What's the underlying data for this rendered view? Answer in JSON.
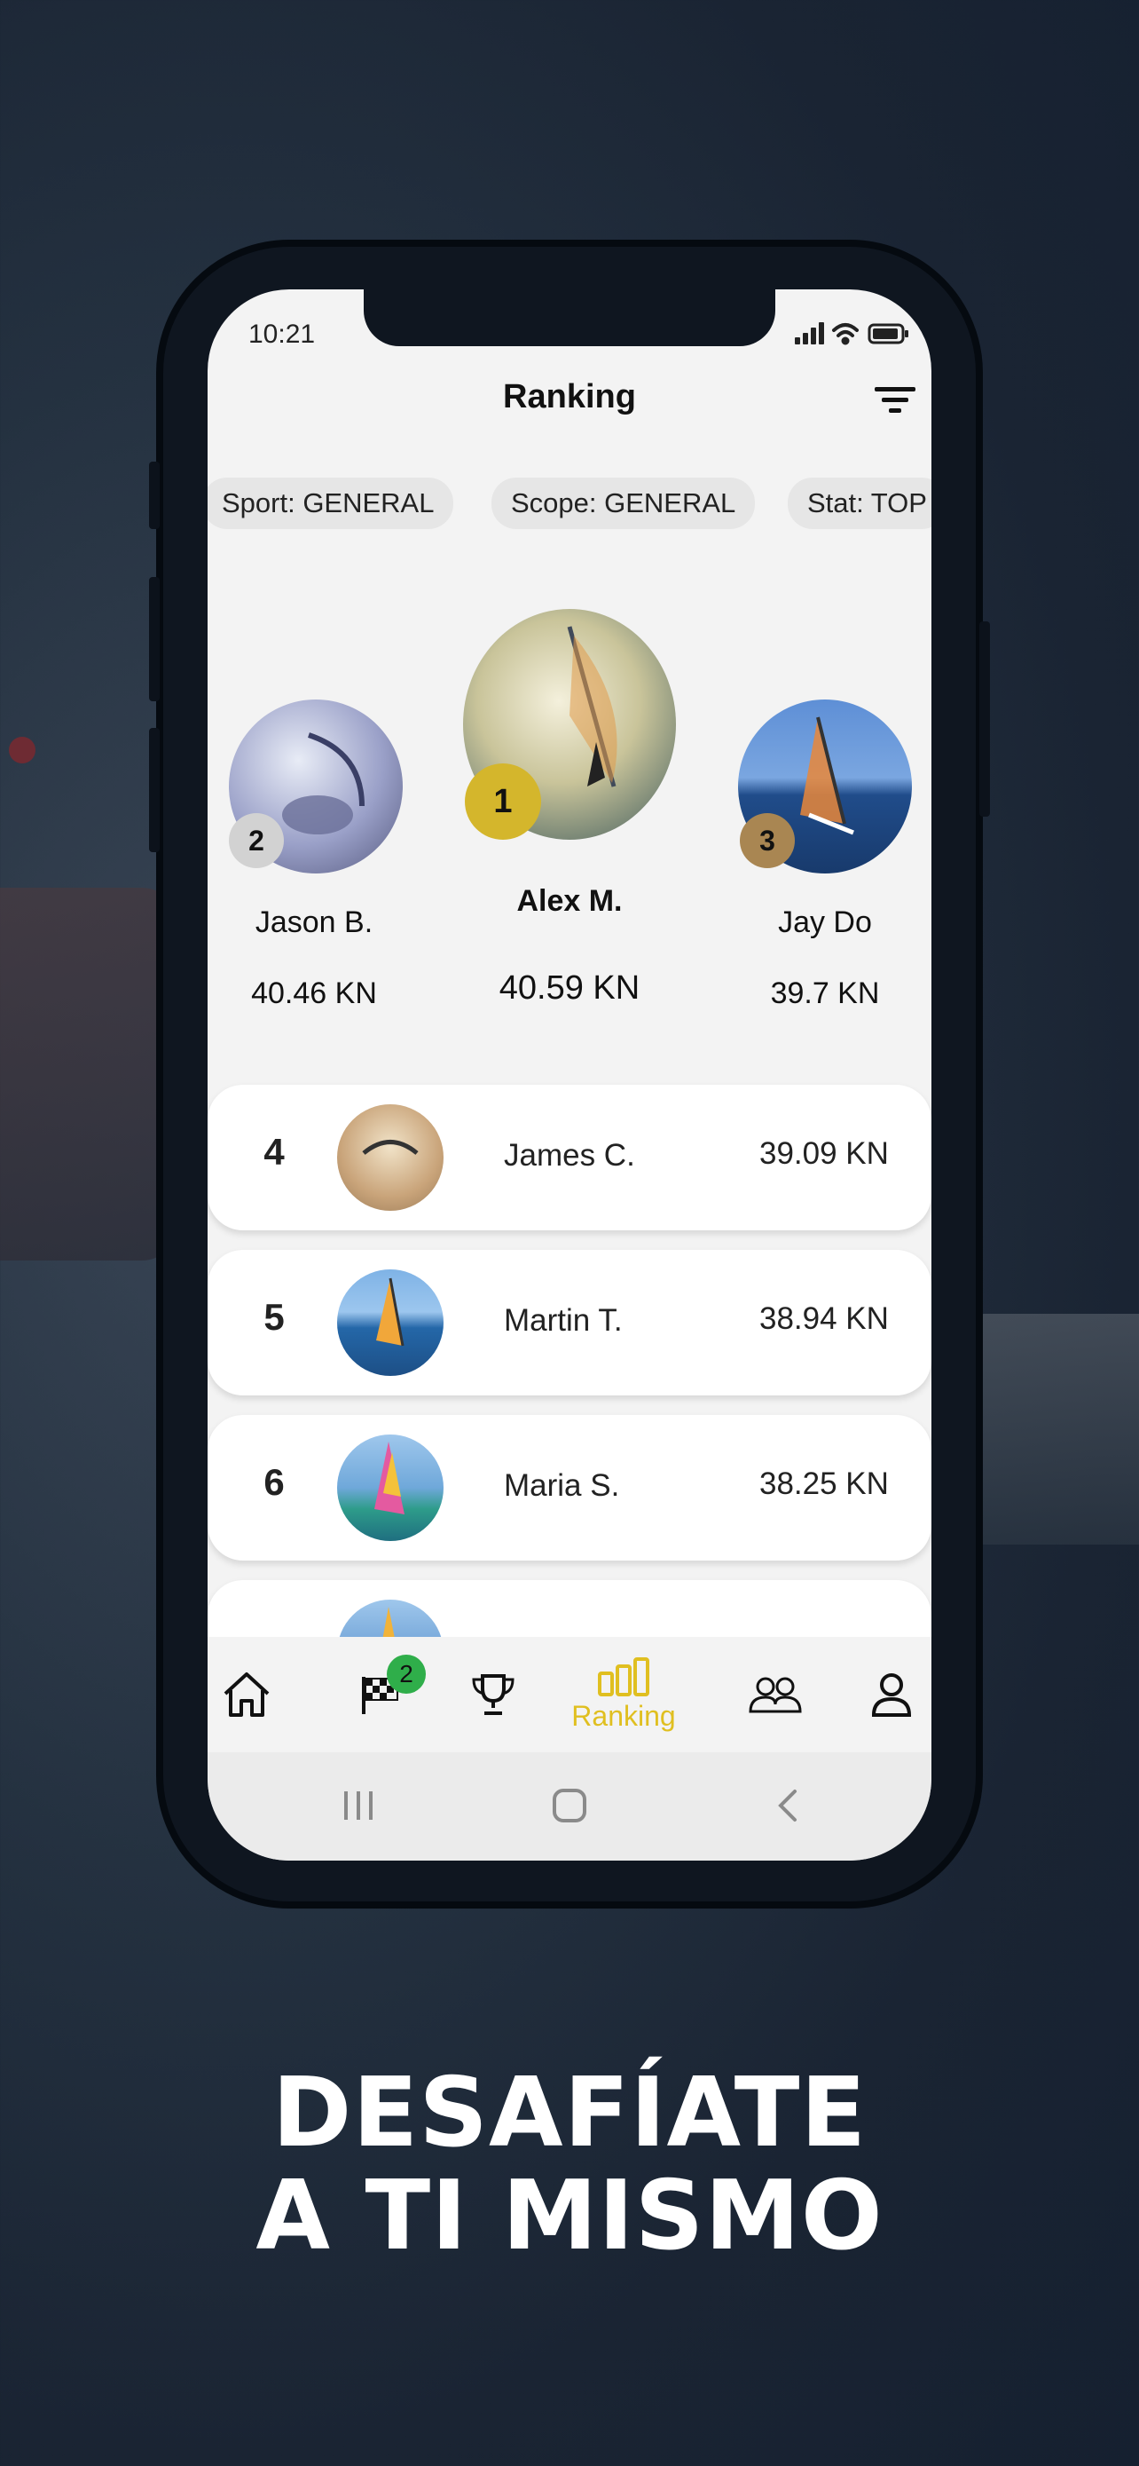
{
  "status": {
    "time": "10:21"
  },
  "header": {
    "title": "Ranking"
  },
  "filters": [
    "Sport: GENERAL",
    "Scope: GENERAL",
    "Stat: TOP"
  ],
  "podium": [
    {
      "rank": "2",
      "name": "Jason B.",
      "value": "40.46 KN"
    },
    {
      "rank": "1",
      "name": "Alex M.",
      "value": "40.59 KN"
    },
    {
      "rank": "3",
      "name": "Jay Do",
      "value": "39.7 KN"
    }
  ],
  "list": [
    {
      "rank": "4",
      "name": "James C.",
      "value": "39.09 KN"
    },
    {
      "rank": "5",
      "name": "Martin T.",
      "value": "38.94 KN"
    },
    {
      "rank": "6",
      "name": "Maria S.",
      "value": "38.25 KN"
    }
  ],
  "tabbar": {
    "challenges_badge": "2",
    "ranking_label": "Ranking"
  },
  "headline": {
    "line1": "DESAFÍATE",
    "line2": "A TI MISMO"
  },
  "colors": {
    "gold": "#d4b62c",
    "silver": "#cfcfcf",
    "bronze": "#a98652",
    "accent": "#e0bf20",
    "badge": "#2fae4a"
  },
  "icons": [
    "filter-icon",
    "home-icon",
    "checkered-flag-icon",
    "trophy-icon",
    "ranking-bars-icon",
    "group-icon",
    "profile-icon"
  ]
}
